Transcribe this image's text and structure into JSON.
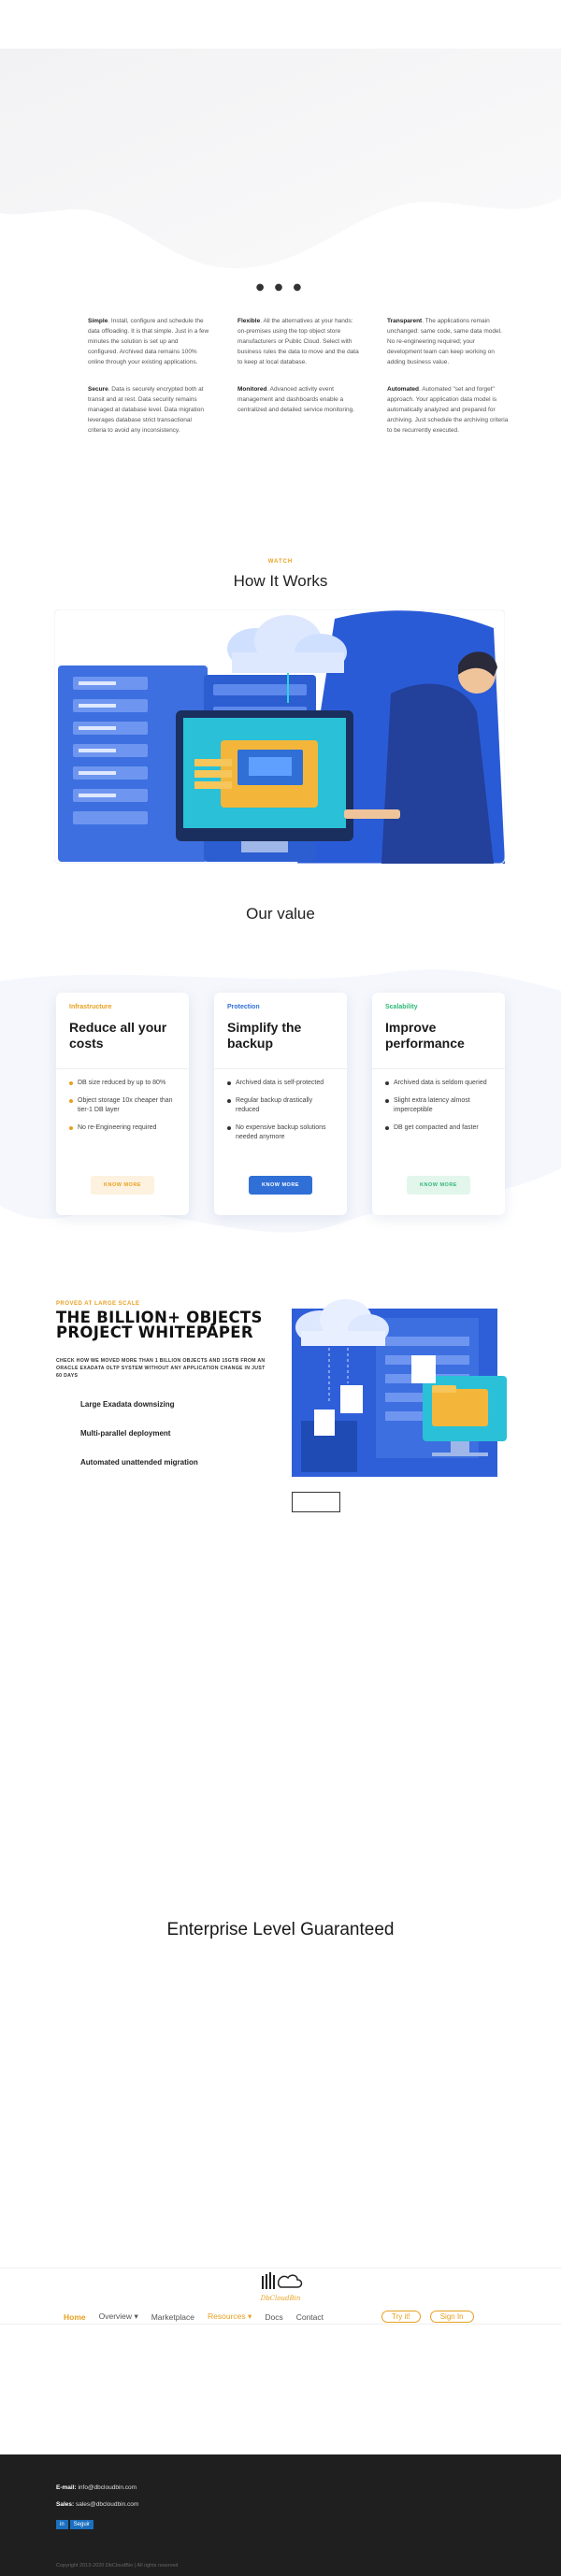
{
  "features": [
    {
      "title": "Simple",
      "text": ". Install, configure and schedule the data offloading. It is that simple. Just in a few minutes the solution is set up and configured. Archived data remains 100% online through your existing applications."
    },
    {
      "title": "Flexible",
      "text": ". All the alternatives at your hands: on-premises using the top object store manufacturers or Public Cloud. Select with business rules the data to move and the data to keep at local database."
    },
    {
      "title": "Transparent",
      "text": ". The applications remain unchanged: same code, same data model. No re-engineering required; your development team can keep working on adding business value."
    },
    {
      "title": "Secure",
      "text": ". Data is securely encrypted both at transit and at rest. Data security remains managed at database level. Data migration leverages database strict transactional criteria to avoid any inconsistency."
    },
    {
      "title": "Monitored",
      "text": ". Advanced activity event management and dashboards enable a centralized and detailed service monitoring."
    },
    {
      "title": "Automated",
      "text": ". Automated \"set and forget\" approach. Your application data model is automatically analyzed and prepared for archiving. Just schedule the archiving criteria to be recurrently executed."
    }
  ],
  "how": {
    "eyebrow": "WATCH",
    "title": "How It Works"
  },
  "value": {
    "title": "Our value",
    "cards": [
      {
        "tag": "Infrastructure",
        "heading": "Reduce all your costs",
        "color": "#e8a020",
        "btn_bg": "#fdf1df",
        "btn_fg": "#e8a020",
        "bullets": [
          "DB size reduced by up to 80%",
          "Object storage 10x cheaper than tier-1 DB layer",
          "No re-Engineering required"
        ],
        "button": "KNOW MORE"
      },
      {
        "tag": "Protection",
        "heading": "Simplify the backup",
        "color": "#2f6fd6",
        "btn_bg": "#2f6fd6",
        "btn_fg": "#ffffff",
        "bullets": [
          "Archived data is self-protected",
          "Regular backup drastically reduced",
          "No expensive backup solutions needed anymore"
        ],
        "button": "KNOW MORE"
      },
      {
        "tag": "Scalability",
        "heading": "Improve performance",
        "color": "#2fb877",
        "btn_bg": "#e3f6ec",
        "btn_fg": "#2fb877",
        "bullets": [
          "Archived data is seldom queried",
          "Slight extra latency almost imperceptible",
          "DB get compacted and faster"
        ],
        "button": "KNOW MORE"
      }
    ]
  },
  "whitepaper": {
    "eyebrow": "PROVED AT LARGE SCALE",
    "title": "THE BILLION+ OBJECTS PROJECT WHITEPAPER",
    "subtitle": "CHECK HOW WE MOVED MORE THAN 1 BILLION OBJECTS AND 15GTB FROM AN ORACLE EXADATA OLTP SYSTEM WITHOUT ANY APPLICATION CHANGE IN JUST 60 DAYS",
    "points": [
      "Large Exadata downsizing",
      "Multi-parallel deployment",
      "Automated unattended migration"
    ]
  },
  "enterprise": {
    "title": "Enterprise Level Guaranteed"
  },
  "nav": {
    "logo_text": "DbCloudBin",
    "items": [
      "Home",
      "Overview",
      "Marketplace",
      "Resources",
      "Docs",
      "Contact"
    ],
    "try": "Try it!",
    "signin": "Sign In"
  },
  "footer": {
    "email_label": "E-mail:",
    "email": "info@dbcloudbin.com",
    "sales_label": "Sales:",
    "sales": "sales@dbcloudbin.com",
    "social_in": "in",
    "social_label": "Seguir",
    "copyright": "Copyright 2013-2020 DbCloudBin | All rights reserved"
  },
  "colors": {
    "accent": "#e8a020",
    "primary": "#2f6fd6",
    "green": "#2fb877",
    "footer_bg": "#1f1f1f"
  }
}
